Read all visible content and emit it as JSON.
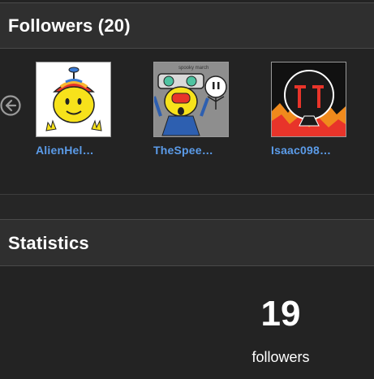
{
  "followers_panel": {
    "title": "Followers (20)",
    "prev_icon": "arrow-left-circle-icon",
    "items": [
      {
        "name": "AlienHel…",
        "avatar_icon": "yellow-alien-propeller-hat-avatar"
      },
      {
        "name": "TheSpee…",
        "avatar_icon": "spooky-march-robot-avatar",
        "avatar_caption": "spooky march"
      },
      {
        "name": "Isaac098…",
        "avatar_icon": "red-fire-mask-avatar"
      }
    ]
  },
  "statistics_panel": {
    "title": "Statistics",
    "followers_count": "19",
    "followers_label": "followers"
  },
  "colors": {
    "background": "#232323",
    "header_bg": "#2f2f2f",
    "link": "#5b9be8"
  }
}
